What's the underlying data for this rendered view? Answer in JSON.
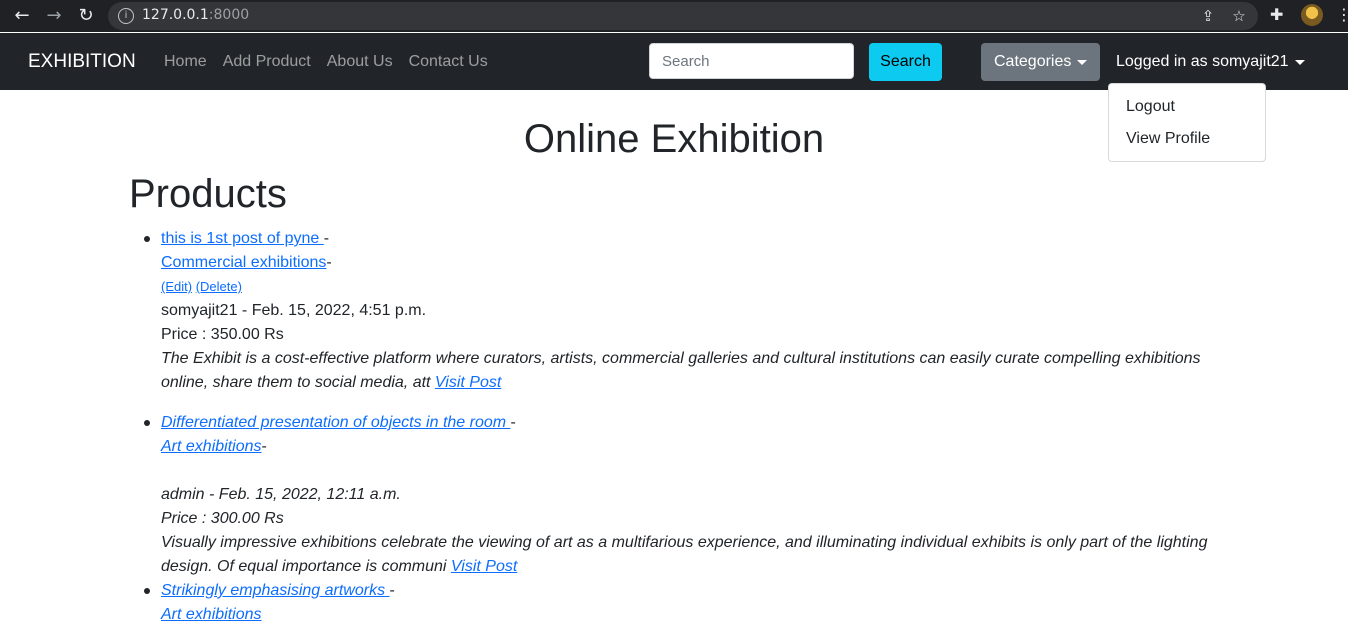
{
  "browser": {
    "url_host": "127.0.0.1",
    "url_port": ":8000"
  },
  "navbar": {
    "brand": "EXHIBITION",
    "links": [
      "Home",
      "Add Product",
      "About Us",
      "Contact Us"
    ],
    "search_placeholder": "Search",
    "search_button": "Search",
    "categories_button": "Categories",
    "user_label": "Logged in as somyajit21"
  },
  "user_menu": {
    "items": [
      "Logout",
      "View Profile"
    ]
  },
  "page_title": "Online Exhibition",
  "section_title": "Products",
  "products": [
    {
      "title": "this is 1st post of pyne ",
      "category": "Commercial exhibitions",
      "edit": "(Edit)",
      "delete": "(Delete)",
      "meta": "somyajit21 - Feb. 15, 2022, 4:51 p.m.",
      "price": "Price : 350.00 Rs",
      "desc_line1": "The Exhibit is a cost-effective platform where curators, artists, commercial galleries and cultural institutions can easily curate compelling exhibitions",
      "desc_line2": "online, share them to social media, att ",
      "visit": "Visit Post"
    },
    {
      "title": "Differentiated presentation of objects in the room ",
      "category": "Art exhibitions",
      "meta": "admin - Feb. 15, 2022, 12:11 a.m.",
      "price": "Price : 300.00 Rs",
      "desc_line1": "Visually impressive exhibitions celebrate the viewing of art as a multifarious experience, and illuminating individual exhibits is only part of the lighting",
      "desc_line2": "design. Of equal importance is communi ",
      "visit": "Visit Post"
    },
    {
      "title": "Strikingly emphasising artworks ",
      "category": "Art exhibitions"
    }
  ]
}
